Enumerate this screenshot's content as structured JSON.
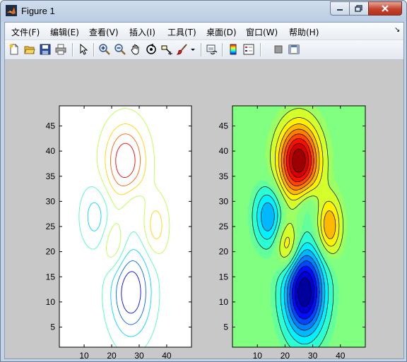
{
  "window": {
    "title": "Figure 1"
  },
  "menu": [
    {
      "label": "文件(F)"
    },
    {
      "label": "编辑(E)"
    },
    {
      "label": "查看(V)"
    },
    {
      "label": "插入(I)"
    },
    {
      "label": "工具(T)"
    },
    {
      "label": "桌面(D)"
    },
    {
      "label": "窗口(W)"
    },
    {
      "label": "帮助(H)"
    }
  ],
  "toolbar_icons": [
    "new-figure-icon",
    "open-file-icon",
    "save-icon",
    "print-icon",
    "edit-plot-arrow-icon",
    "zoom-in-icon",
    "zoom-out-icon",
    "pan-hand-icon",
    "rotate-3d-icon",
    "data-cursor-icon",
    "brush-icon",
    "link-plot-icon",
    "colorbar-icon",
    "legend-icon",
    "hide-plot-tools-icon",
    "show-plot-tools-icon"
  ],
  "chart_data": [
    {
      "type": "contour",
      "x_ticks": [
        "10",
        "20",
        "30",
        "40"
      ],
      "y_ticks": [
        "5",
        "10",
        "15",
        "20",
        "25",
        "30",
        "35",
        "40",
        "45"
      ],
      "xlim": [
        1,
        49
      ],
      "ylim": [
        1,
        49
      ],
      "filled": false,
      "colormap": "jet",
      "peaks": [
        {
          "x": 25,
          "y": 38,
          "sign": "max"
        },
        {
          "x": 27,
          "y": 12,
          "sign": "min"
        }
      ]
    },
    {
      "type": "contour",
      "x_ticks": [
        "10",
        "20",
        "30",
        "40"
      ],
      "y_ticks": [
        "5",
        "10",
        "15",
        "20",
        "25",
        "30",
        "35",
        "40",
        "45"
      ],
      "xlim": [
        1,
        49
      ],
      "ylim": [
        1,
        49
      ],
      "filled": true,
      "colormap": "jet",
      "peaks": [
        {
          "x": 25,
          "y": 38,
          "sign": "max"
        },
        {
          "x": 27,
          "y": 12,
          "sign": "min"
        }
      ]
    }
  ]
}
